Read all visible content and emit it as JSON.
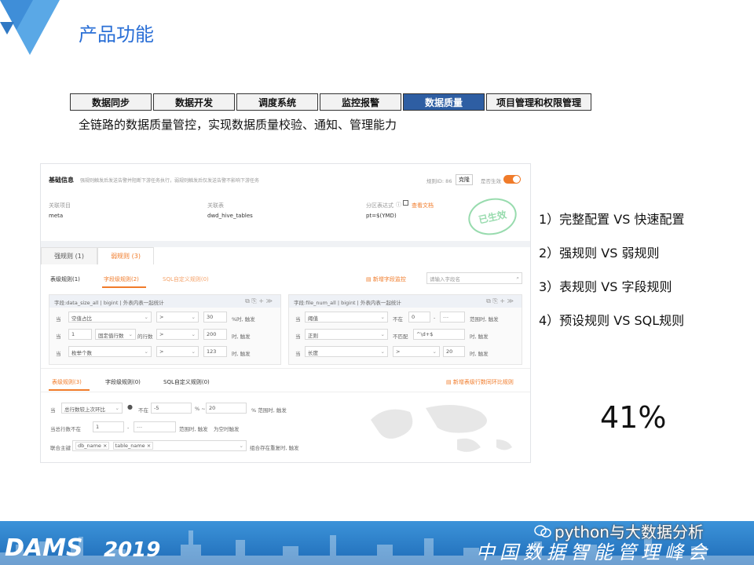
{
  "slide": {
    "title": "产品功能",
    "subtitle": "全链路的数据质量管控，实现数据质量校验、通知、管理能力",
    "colors": {
      "title": "#2a6fd6",
      "tab_active": "#2e5ea3",
      "accent": "#f07b2a",
      "footer": "#1f6cb8"
    }
  },
  "tabs": [
    {
      "label": "数据同步",
      "active": false
    },
    {
      "label": "数据开发",
      "active": false
    },
    {
      "label": "调度系统",
      "active": false
    },
    {
      "label": "监控报警",
      "active": false
    },
    {
      "label": "数据质量",
      "active": true
    },
    {
      "label": "项目管理和权限管理",
      "active": false
    }
  ],
  "app": {
    "basic_info": {
      "title": "基础信息",
      "hint": "强规则触发后发送告警并阻断下游任务执行，弱规则触发后仅发送告警不影响下游任务",
      "rule_id_label": "规则ID: 86",
      "copy_button": "克隆",
      "effective_label": "是否生效",
      "toggle_on": "开",
      "project_label": "关联项目",
      "project_value": "meta",
      "table_label": "关联表",
      "table_value": "dwd_hive_tables",
      "partition_label": "分区表达式",
      "doc_link": "查看文档",
      "partition_value": "pt=$(YMD)",
      "stamp": "已生效"
    },
    "rule_tabs": {
      "strong": "强规则 (1)",
      "weak": "弱规则 (3)"
    },
    "sub_tabs": {
      "table": "表级规则(1)",
      "field": "字段级规则(2)",
      "sql": "SQL自定义规则(0)",
      "add_monitor": "新增字段监控",
      "search_placeholder": "请输入字段名"
    },
    "panel_left": {
      "head": "字段:data_size_all  |  bigint  |  外表内表一起统计",
      "rows": [
        {
          "when": "当",
          "metric": "空值占比",
          "op": ">",
          "value": "30",
          "suffix": "%时, 触发"
        },
        {
          "when": "当",
          "pre": "1",
          "metric": "固定值行数",
          "mid": "的行数",
          "op": ">",
          "value": "200",
          "suffix": "时, 触发"
        },
        {
          "when": "当",
          "metric": "枚举个数",
          "op": ">",
          "value": "123",
          "suffix": "时, 触发"
        }
      ]
    },
    "panel_right": {
      "head": "字段:file_num_all  |  bigint  |  外表内表一起统计",
      "rows": [
        {
          "when": "当",
          "metric": "阈值",
          "op": "不在",
          "value": "0",
          "to": "---",
          "suffix": "范围时, 触发"
        },
        {
          "when": "当",
          "metric": "正则",
          "op": "不匹配",
          "value": "^\\d+$",
          "suffix": "时, 触发"
        },
        {
          "when": "当",
          "metric": "长度",
          "op": ">",
          "value": "20",
          "suffix": "时, 触发"
        }
      ]
    },
    "bottom_tabs": {
      "table": "表级规则(3)",
      "field": "字段级规则(0)",
      "sql": "SQL自定义规则(0)",
      "add_link": "新增表级行数同环比规则"
    },
    "bottom_rows": {
      "r1_when": "当",
      "r1_metric": "总行数较上次环比",
      "r1_not_in": "不在",
      "r1_from": "-5",
      "r1_mid": "% ~",
      "r1_to": "20",
      "r1_suffix": "% 范围时, 触发",
      "r2_label": "当总行数不在",
      "r2_from": "1",
      "r2_to": "---",
      "r2_suffix": "范围时, 触发",
      "r2_link": "为空时触发",
      "r3_label": "联合主键",
      "r3_tags": [
        "db_name",
        "table_name"
      ],
      "r3_suffix": "组合存在重复时, 触发"
    }
  },
  "right_list": [
    "1）完整配置 VS 快速配置",
    "2）强规则 VS 弱规则",
    "3）表规则 VS 字段规则",
    "4）预设规则 VS SQL规则"
  ],
  "percent": "41%",
  "footer": {
    "brand": "DAMS",
    "year": "2019",
    "summit": "中国数据智能管理峰会",
    "watermark": "python与大数据分析"
  }
}
